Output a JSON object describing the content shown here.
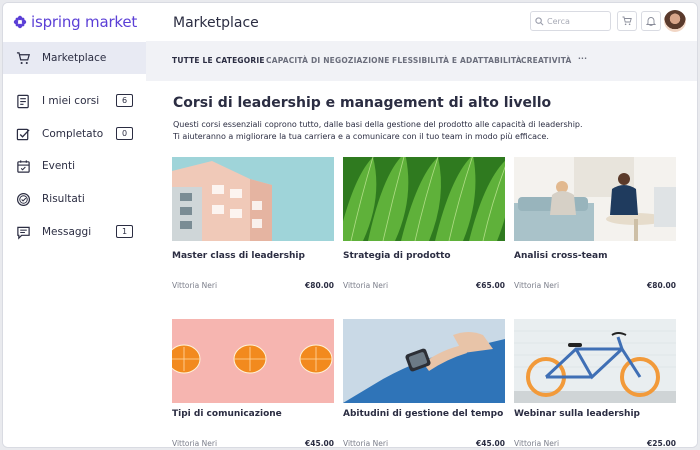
{
  "app": {
    "logo_light": "ispring",
    "logo_bold": "market",
    "title": "Marketplace",
    "brand_color": "#5b3fd6"
  },
  "search": {
    "placeholder": "Cerca",
    "icon": "search-icon"
  },
  "toolbar_icons": [
    "cart-icon",
    "bell-icon"
  ],
  "sidebar": {
    "items": [
      {
        "label": "Marketplace",
        "icon": "cart-icon",
        "active": true
      },
      {
        "label": "I miei corsi",
        "icon": "courses-icon",
        "badge": "6"
      },
      {
        "label": "Completato",
        "icon": "check-icon",
        "badge": "0"
      },
      {
        "label": "Eventi",
        "icon": "calendar-icon"
      },
      {
        "label": "Risultati",
        "icon": "badge-icon"
      },
      {
        "label": "Messaggi",
        "icon": "message-icon",
        "badge": "1"
      }
    ]
  },
  "tabs": [
    {
      "label": "TUTTE LE CATEGORIE",
      "active": true
    },
    {
      "label": "CAPACITÀ DI NEGOZIAZIONE"
    },
    {
      "label": "FLESSIBILITÀ E ADATTABILITÀ"
    },
    {
      "label": "CREATIVITÀ"
    },
    {
      "label": "···"
    }
  ],
  "main": {
    "heading": "Corsi di leadership e management di alto livello",
    "description_line1": "Questi corsi essenziali coprono tutto, dalle basi della gestione del prodotto alle capacità di leadership.",
    "description_line2": "Ti aiuteranno a migliorare la tua carriera e a comunicare con il tuo team in modo più efficace."
  },
  "cards": [
    {
      "title": "Master class di leadership",
      "author": "Vittoria Neri",
      "price": "€80.00"
    },
    {
      "title": "Strategia di prodotto",
      "author": "Vittoria Neri",
      "price": "€65.00"
    },
    {
      "title": "Analisi cross-team",
      "author": "Vittoria Neri",
      "price": "€80.00"
    },
    {
      "title": "Tipi di comunicazione",
      "author": "Vittoria Neri",
      "price": "€45.00"
    },
    {
      "title": "Abitudini di gestione del tempo",
      "author": "Vittoria Neri",
      "price": "€45.00"
    },
    {
      "title": "Webinar sulla leadership",
      "author": "Vittoria Neri",
      "price": "€25.00"
    }
  ]
}
